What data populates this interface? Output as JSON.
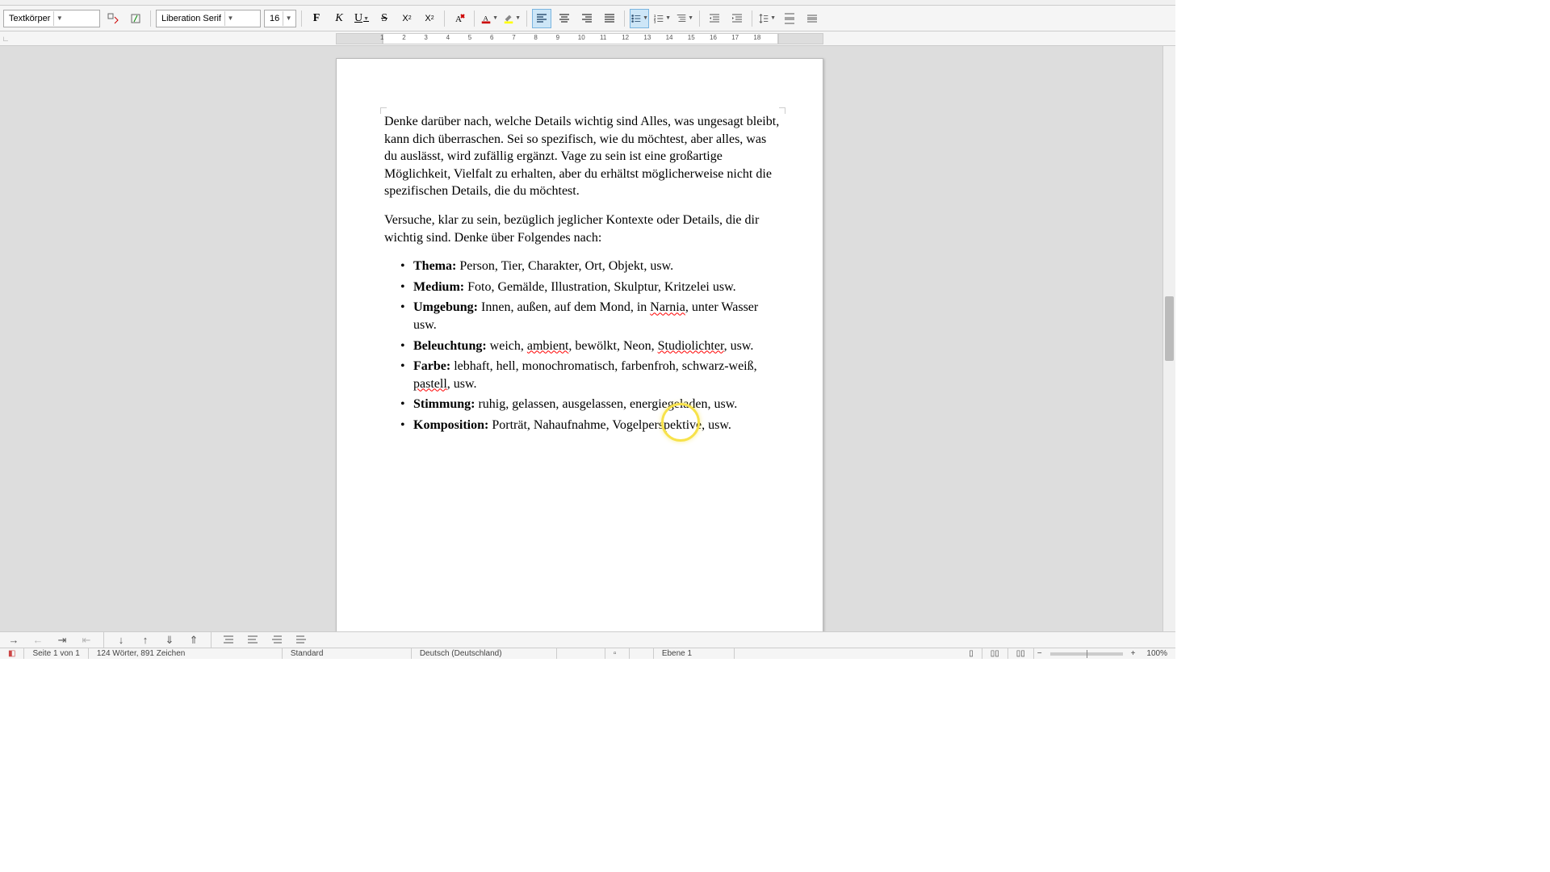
{
  "toolbar": {
    "style": "Textkörper",
    "font": "Liberation Serif",
    "size": "16"
  },
  "ruler": {
    "ticks": [
      "1",
      "2",
      "3",
      "4",
      "5",
      "6",
      "7",
      "8",
      "9",
      "10",
      "11",
      "12",
      "13",
      "14",
      "15",
      "16",
      "17",
      "18"
    ]
  },
  "doc": {
    "para1": "Denke darüber nach, welche Details wichtig sind Alles, was ungesagt bleibt, kann dich überraschen. Sei so spezifisch, wie du möchtest, aber alles, was du auslässt, wird zufällig ergänzt. Vage zu sein ist eine großartige Möglichkeit, Vielfalt zu erhalten, aber du erhältst möglicherweise nicht die spezifischen Details, die du möchtest.",
    "para2": "Versuche, klar zu sein, bezüglich jeglicher Kontexte oder Details, die dir wichtig sind. Denke über Folgendes nach:",
    "bullets": {
      "thema_label": "Thema:",
      "thema_text": " Person, Tier, Charakter, Ort, Objekt, usw.",
      "medium_label": "Medium:",
      "medium_text": " Foto, Gemälde, Illustration, Skulptur, Kritzelei usw.",
      "umgebung_label": "Umgebung:",
      "umgebung_pre": " Innen, außen, auf dem Mond, in ",
      "umgebung_sq1": "Narnia",
      "umgebung_post": ", unter Wasser usw.",
      "beleuchtung_label": "Beleuchtung:",
      "beleuchtung_pre": " weich, ",
      "beleuchtung_sq1": "ambient",
      "beleuchtung_mid": ", bewölkt, Neon, ",
      "beleuchtung_sq2": "Studiolichter",
      "beleuchtung_post": ", usw.",
      "farbe_label": "Farbe:",
      "farbe_pre": " lebhaft, hell, monochromatisch, farbenfroh, schwarz-weiß, ",
      "farbe_sq1": "pastell",
      "farbe_post": ", usw.",
      "stimmung_label": "Stimmung:",
      "stimmung_text": " ruhig, gelassen, ausgelassen, energiegeladen, usw.",
      "komposition_label": "Komposition:",
      "komposition_text": " Porträt, Nahaufnahme, Vogelperspektive, usw."
    }
  },
  "status": {
    "page": "Seite 1 von 1",
    "words": "124 Wörter, 891 Zeichen",
    "style": "Standard",
    "lang": "Deutsch (Deutschland)",
    "layer": "Ebene 1",
    "zoom": "100%"
  }
}
